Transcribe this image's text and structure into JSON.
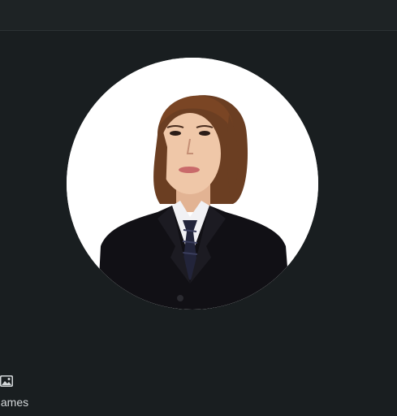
{
  "sidebar": {
    "item": {
      "icon": "photo-icon",
      "label": "Games"
    }
  },
  "profile": {
    "photo": "avatar-photo"
  },
  "colors": {
    "background": "#191e20",
    "top_bar": "#1e2325",
    "text": "#d4d8da"
  }
}
